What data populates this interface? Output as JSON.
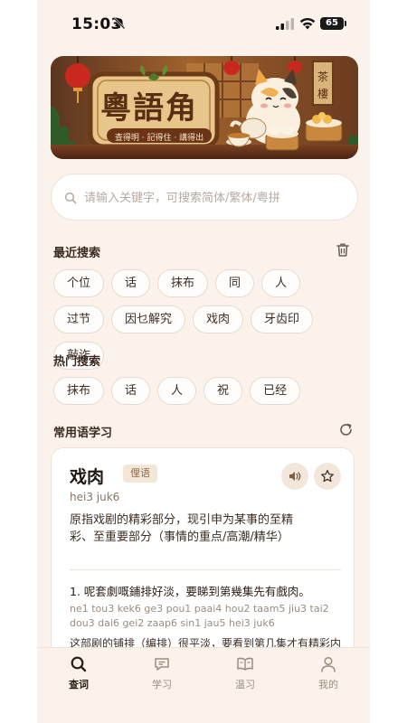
{
  "status": {
    "time": "15:03",
    "battery": "65"
  },
  "banner": {
    "title": "粵語角",
    "subtitle": "查得明 · 記得住 · 講得出",
    "sign": "茶樓"
  },
  "search": {
    "placeholder": "请输入关键字，可搜索简体/繁体/粤拼"
  },
  "recent": {
    "title": "最近搜索",
    "items": [
      "个位",
      "话",
      "抹布",
      "同",
      "人",
      "过节",
      "因乜解究",
      "戏肉",
      "牙齿印",
      "敲诈"
    ]
  },
  "hot": {
    "title": "热门搜索",
    "items": [
      "抹布",
      "话",
      "人",
      "祝",
      "已经"
    ]
  },
  "phrases": {
    "title": "常用语学习",
    "card": {
      "word": "戏肉",
      "tag": "俚语",
      "jyutping": "hei3 juk6",
      "definition": "原指戏剧的精彩部分，现引申为某事的至精彩、至重要部分（事情的重点/高潮/精华）",
      "example": "1. 呢套劇嘅鋪排好淡，要睇到第幾集先有戲肉。",
      "example_jyutping_1": "ne1 tou3 kek6 ge3 pou1 paai4 hou2 taam5 jiu3 tai2",
      "example_jyutping_2": "dou3 dai6 gei2 zaap6 sin1 jau5 hei3 juk6",
      "example_translation": "这部剧的铺排（编排）很平淡，要看到第几集才有精彩内容。"
    }
  },
  "tabs": [
    {
      "label": "查词",
      "icon": "search-icon"
    },
    {
      "label": "学习",
      "icon": "chat-icon"
    },
    {
      "label": "温习",
      "icon": "book-icon"
    },
    {
      "label": "我的",
      "icon": "user-icon"
    }
  ],
  "colors": {
    "background": "#fbf3eb",
    "accent": "#2a1d14",
    "chip_border": "#e7dbd0",
    "tag_bg": "#f3e7d8"
  }
}
